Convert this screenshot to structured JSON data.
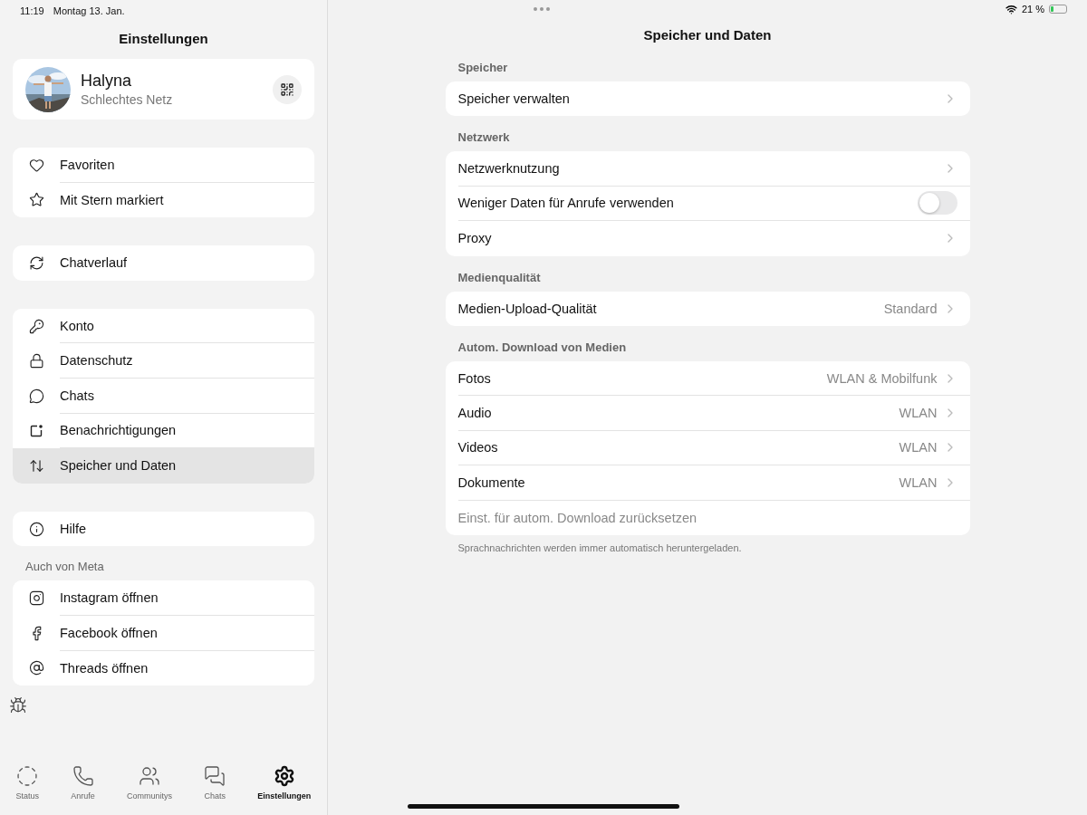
{
  "status_bar": {
    "time": "11:19",
    "date": "Montag 13. Jan.",
    "battery": "21 %"
  },
  "sidebar": {
    "title": "Einstellungen",
    "profile": {
      "name": "Halyna",
      "status": "Schlechtes Netz"
    },
    "groups": [
      {
        "items": [
          {
            "label": "Favoriten",
            "selected": false
          },
          {
            "label": "Mit Stern markiert",
            "selected": false
          }
        ]
      },
      {
        "items": [
          {
            "label": "Chatverlauf",
            "selected": false
          }
        ]
      },
      {
        "items": [
          {
            "label": "Konto",
            "selected": false
          },
          {
            "label": "Datenschutz",
            "selected": false
          },
          {
            "label": "Chats",
            "selected": false
          },
          {
            "label": "Benachrichtigungen",
            "selected": false
          },
          {
            "label": "Speicher und Daten",
            "selected": true
          }
        ]
      },
      {
        "items": [
          {
            "label": "Hilfe",
            "selected": false
          }
        ]
      },
      {
        "header": "Auch von Meta",
        "items": [
          {
            "label": "Instagram öffnen",
            "selected": false
          },
          {
            "label": "Facebook öffnen",
            "selected": false
          },
          {
            "label": "Threads öffnen",
            "selected": false
          }
        ]
      }
    ]
  },
  "tabs": [
    {
      "label": "Status",
      "selected": false
    },
    {
      "label": "Anrufe",
      "selected": false
    },
    {
      "label": "Communitys",
      "selected": false
    },
    {
      "label": "Chats",
      "selected": false
    },
    {
      "label": "Einstellungen",
      "selected": true
    }
  ],
  "detail": {
    "title": "Speicher und Daten",
    "sections": [
      {
        "header": "Speicher",
        "rows": [
          {
            "kind": "link",
            "label": "Speicher verwalten"
          }
        ]
      },
      {
        "header": "Netzwerk",
        "rows": [
          {
            "kind": "link",
            "label": "Netzwerknutzung"
          },
          {
            "kind": "toggle",
            "label": "Weniger Daten für Anrufe verwenden",
            "on": false
          },
          {
            "kind": "link",
            "label": "Proxy"
          }
        ]
      },
      {
        "header": "Medienqualität",
        "rows": [
          {
            "kind": "link",
            "label": "Medien-Upload-Qualität",
            "value": "Standard"
          }
        ]
      },
      {
        "header": "Autom. Download von Medien",
        "rows": [
          {
            "kind": "link",
            "label": "Fotos",
            "value": "WLAN & Mobilfunk"
          },
          {
            "kind": "link",
            "label": "Audio",
            "value": "WLAN"
          },
          {
            "kind": "link",
            "label": "Videos",
            "value": "WLAN"
          },
          {
            "kind": "link",
            "label": "Dokumente",
            "value": "WLAN"
          },
          {
            "kind": "action",
            "label": "Einst. für autom. Download zurücksetzen"
          }
        ],
        "footer": "Sprachnachrichten werden immer automatisch heruntergeladen."
      }
    ]
  }
}
